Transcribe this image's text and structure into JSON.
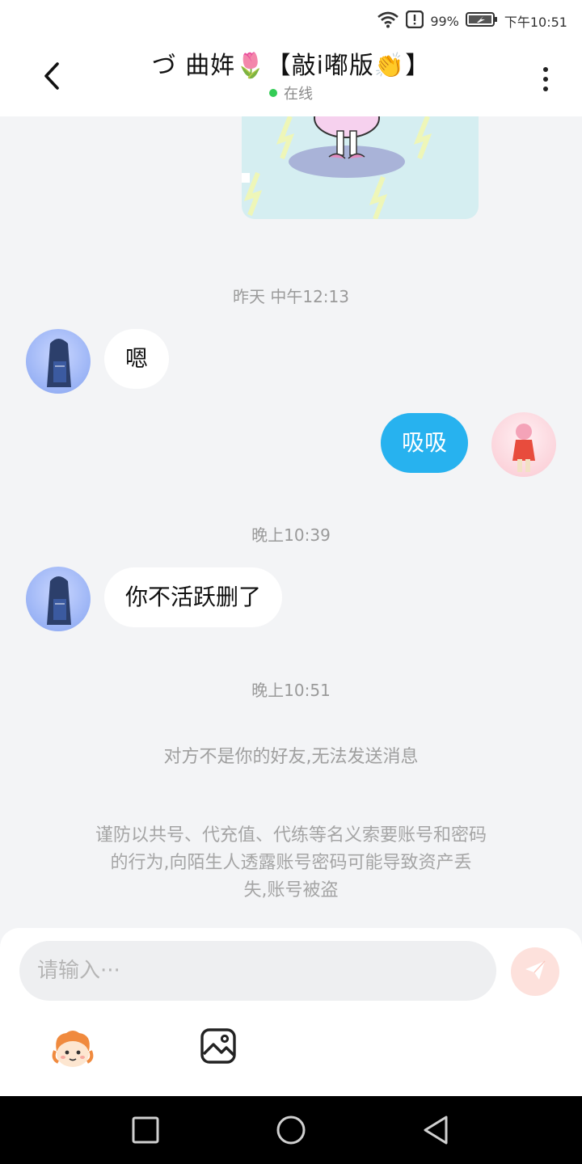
{
  "status_bar": {
    "battery_percent": "99%",
    "time": "下午10:51"
  },
  "header": {
    "title": "づ 曲姩🌷【敲i嘟版👏】",
    "presence": "在线"
  },
  "messages": {
    "ts1": "昨天 中午12:13",
    "msg1": "嗯",
    "msg2": "吸吸",
    "ts2": "晚上10:39",
    "msg3": "你不活跃删了",
    "ts3": "晚上10:51",
    "system_notice": "对方不是你的好友,无法发送消息",
    "warning_line1": "谨防以共号、代充值、代练等名义索要账号和密码",
    "warning_line2": "的行为,向陌生人透露账号密码可能导致资产丢",
    "warning_line3": "失,账号被盗"
  },
  "composer": {
    "placeholder": "请输入···"
  },
  "icons": {
    "back": "back-arrow-icon",
    "more": "more-vertical-icon",
    "send": "send-icon",
    "emoji": "emoji-mascot-icon",
    "image": "image-icon",
    "wifi": "wifi-icon",
    "battery": "battery-icon"
  },
  "colors": {
    "accent_blue": "#27b2ef",
    "online_green": "#33cc55",
    "send_bg": "#fde1dc"
  }
}
